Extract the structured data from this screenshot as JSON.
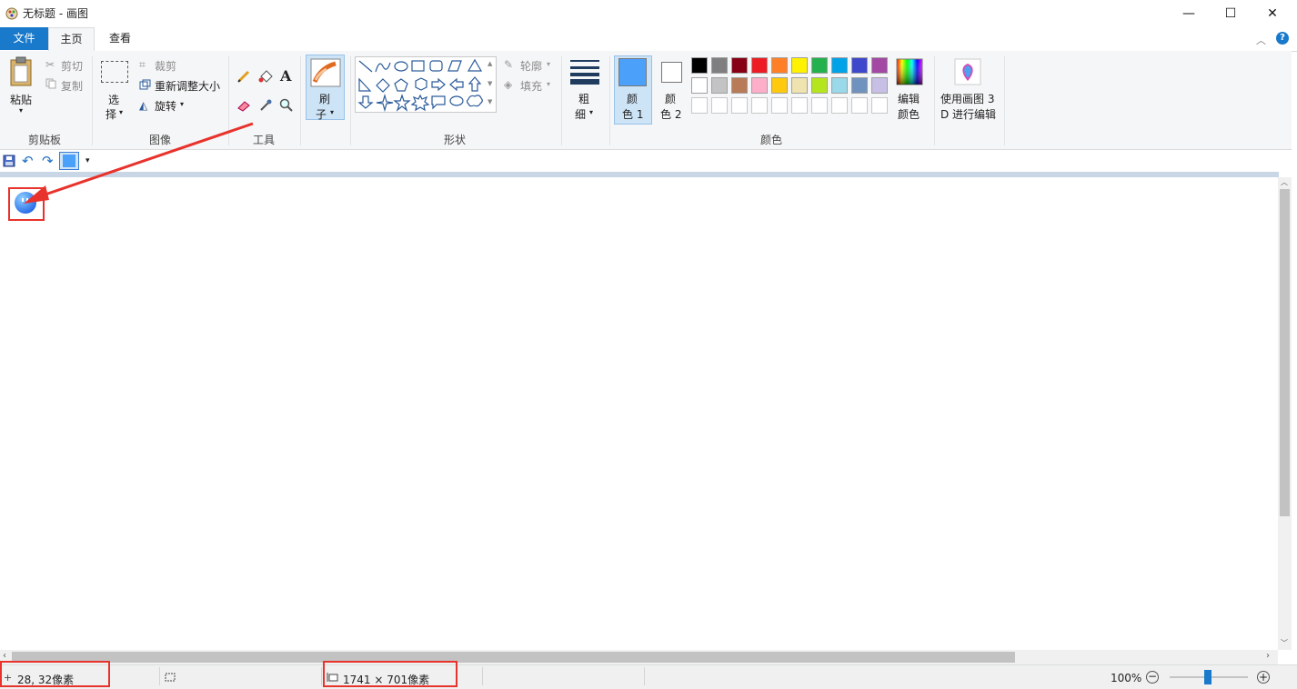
{
  "window": {
    "title": "无标题 - 画图",
    "minimize": "—",
    "maximize": "☐",
    "close": "✕"
  },
  "tabs": [
    {
      "label": "文件"
    },
    {
      "label": "主页"
    },
    {
      "label": "查看"
    }
  ],
  "ribbon": {
    "clipboard": {
      "paste": "粘贴",
      "cut": "剪切",
      "copy": "复制",
      "group": "剪贴板"
    },
    "image": {
      "select_top": "选",
      "select_bottom": "择",
      "crop": "裁剪",
      "resize": "重新调整大小",
      "rotate": "旋转",
      "group": "图像"
    },
    "tools": {
      "group": "工具",
      "text_tool": "A"
    },
    "brush": {
      "top": "刷",
      "bottom": "子"
    },
    "shapes": {
      "outline": "轮廓",
      "fill": "填充",
      "group": "形状"
    },
    "size": {
      "top": "粗",
      "bottom": "细"
    },
    "colors": {
      "color1_top": "颜",
      "color1_bottom": "色 1",
      "color2_top": "颜",
      "color2_bottom": "色 2",
      "edit_top": "编辑",
      "edit_bottom": "颜色",
      "group": "颜色",
      "color1_value": "#4ba0fa",
      "color2_value": "#ffffff",
      "palette_row1": [
        "#000000",
        "#7f7f7f",
        "#880015",
        "#ed1c24",
        "#ff7f27",
        "#fff200",
        "#22b14c",
        "#00a2e8",
        "#3f48cc",
        "#a349a4"
      ],
      "palette_row2": [
        "#ffffff",
        "#c3c3c3",
        "#b97a57",
        "#ffaec9",
        "#ffc90e",
        "#efe4b0",
        "#b5e61d",
        "#99d9ea",
        "#7092be",
        "#c8bfe7"
      ]
    },
    "paint3d": {
      "line1": "使用画图 3",
      "line2": "D 进行编辑"
    }
  },
  "status": {
    "cursor_pos": "28, 32像素",
    "canvas_size": "1741 × 701像素",
    "zoom": "100%"
  }
}
